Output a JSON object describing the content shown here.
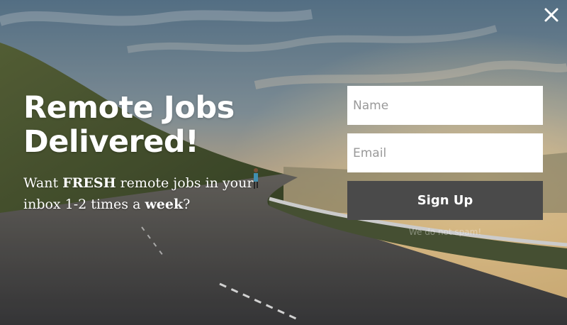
{
  "popup": {
    "headline_line1": "Remote Jobs",
    "headline_line2": "Delivered!",
    "sub_prefix": "Want ",
    "sub_bold1": "FRESH",
    "sub_middle": " remote jobs in your inbox 1-2 times a ",
    "sub_bold2": "week",
    "sub_suffix": "?"
  },
  "form": {
    "name_placeholder": "Name",
    "email_placeholder": "Email",
    "submit_label": "Sign Up",
    "privacy_note": "We do not spam!"
  },
  "icons": {
    "close": "close-icon"
  },
  "colors": {
    "button_bg": "#4a4a4a",
    "input_bg": "#ffffff",
    "text": "#ffffff"
  }
}
